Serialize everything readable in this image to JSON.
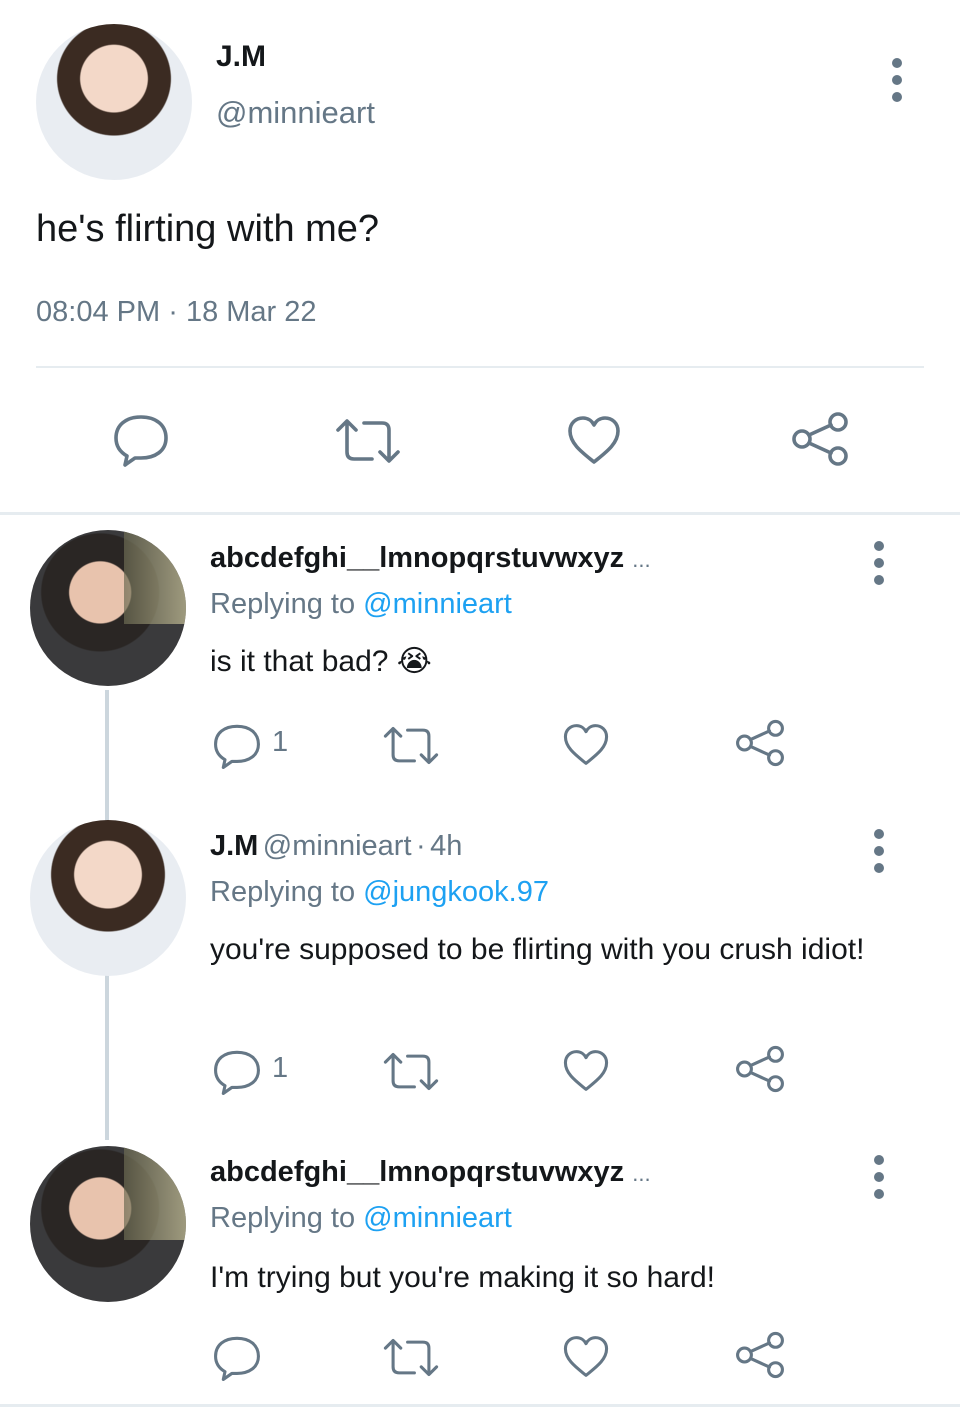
{
  "main_tweet": {
    "name": "J.M",
    "handle": "@minnieart",
    "text": "he's flirting with me?",
    "time": "08:04 PM",
    "date": "18 Mar 22",
    "separator": "·"
  },
  "replies": [
    {
      "name": "abcdefghi__lmnopqrstuvwxyz",
      "name_suffix": "...",
      "replying_label": "Replying to",
      "replying_to": "@minnieart",
      "text": "is it that bad?",
      "emoji": "😭",
      "reply_count": "1"
    },
    {
      "name": "J.M",
      "handle": "@minnieart",
      "time_sep": "·",
      "time": "4h",
      "replying_label": "Replying to",
      "replying_to": "@jungkook.97",
      "text": "you're supposed to be flirting with you crush idiot!",
      "reply_count": "1"
    },
    {
      "name": "abcdefghi__lmnopqrstuvwxyz",
      "name_suffix": "...",
      "replying_label": "Replying to",
      "replying_to": "@minnieart",
      "text": "I'm trying but you're making it so hard!"
    }
  ],
  "icons": [
    "reply-icon",
    "retweet-icon",
    "like-icon",
    "share-icon",
    "more-icon"
  ],
  "colors": {
    "accent": "#1da1f2",
    "muted": "#657786",
    "divider": "#e6ecf0"
  }
}
